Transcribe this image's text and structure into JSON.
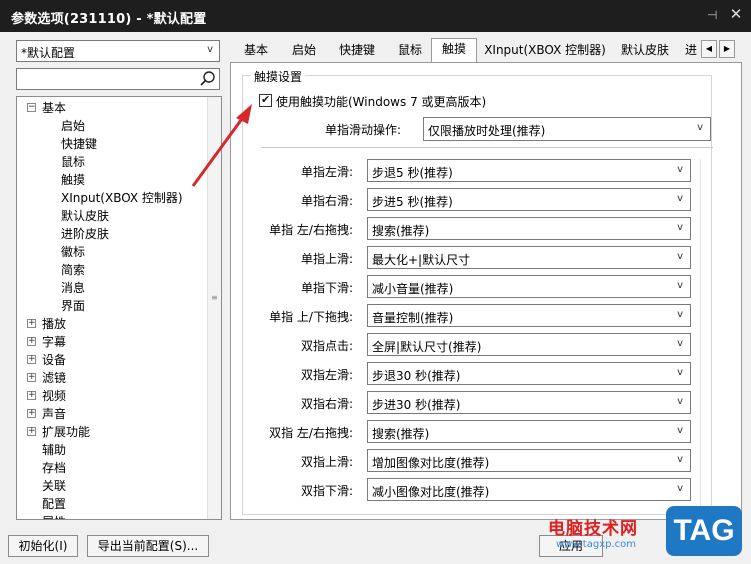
{
  "window": {
    "title": "参数选项(231110) - *默认配置",
    "pin_glyph": "⊣",
    "close_glyph": "✕"
  },
  "profile": {
    "value": "*默认配置"
  },
  "search": {
    "value": ""
  },
  "tree": {
    "items": [
      {
        "label": "基本",
        "expander": "⊟"
      },
      {
        "label": "启始"
      },
      {
        "label": "快捷键"
      },
      {
        "label": "鼠标"
      },
      {
        "label": "触摸"
      },
      {
        "label": "XInput(XBOX 控制器)"
      },
      {
        "label": "默认皮肤"
      },
      {
        "label": "进阶皮肤"
      },
      {
        "label": "徽标"
      },
      {
        "label": "简索"
      },
      {
        "label": "消息"
      },
      {
        "label": "界面"
      },
      {
        "label": "播放",
        "expander": "⊞"
      },
      {
        "label": "字幕",
        "expander": "⊞"
      },
      {
        "label": "设备",
        "expander": "⊞"
      },
      {
        "label": "滤镜",
        "expander": "⊞"
      },
      {
        "label": "视频",
        "expander": "⊞"
      },
      {
        "label": "声音",
        "expander": "⊞"
      },
      {
        "label": "扩展功能",
        "expander": "⊞"
      },
      {
        "label": "辅助"
      },
      {
        "label": "存档"
      },
      {
        "label": "关联"
      },
      {
        "label": "配置"
      },
      {
        "label": "属性"
      }
    ]
  },
  "tabs": [
    {
      "label": "基本"
    },
    {
      "label": "启始"
    },
    {
      "label": "快捷键"
    },
    {
      "label": "鼠标"
    },
    {
      "label": "触摸"
    },
    {
      "label": "XInput(XBOX 控制器)"
    },
    {
      "label": "默认皮肤"
    },
    {
      "label": "进"
    }
  ],
  "touch": {
    "group_title": "触摸设置",
    "enable_label": "使用触摸功能(Windows 7 或更高版本)",
    "enable_checked": true,
    "single_label": "单指滑动操作:",
    "single_value": "仅限播放时处理(推荐)",
    "gestures": [
      {
        "label": "单指左滑:",
        "value": "步退5 秒(推荐)"
      },
      {
        "label": "单指右滑:",
        "value": "步进5 秒(推荐)"
      },
      {
        "label": "单指 左/右拖拽:",
        "value": "搜索(推荐)"
      },
      {
        "label": "单指上滑:",
        "value": "最大化+|默认尺寸"
      },
      {
        "label": "单指下滑:",
        "value": "减小音量(推荐)"
      },
      {
        "label": "单指 上/下拖拽:",
        "value": "音量控制(推荐)"
      },
      {
        "label": "双指点击:",
        "value": "全屏|默认尺寸(推荐)"
      },
      {
        "label": "双指左滑:",
        "value": "步退30 秒(推荐)"
      },
      {
        "label": "双指右滑:",
        "value": "步进30 秒(推荐)"
      },
      {
        "label": "双指 左/右拖拽:",
        "value": "搜索(推荐)"
      },
      {
        "label": "双指上滑:",
        "value": "增加图像对比度(推荐)"
      },
      {
        "label": "双指下滑:",
        "value": "减小图像对比度(推荐)"
      }
    ]
  },
  "footer": {
    "init_label": "初始化(I)",
    "export_label": "导出当前配置(S)...",
    "apply_label": "应用"
  },
  "watermark": {
    "text": "电脑技术网",
    "url": "www.tagxp.com",
    "tag": "TAG"
  },
  "colors": {
    "titlebar": "#1e1e1e",
    "annotation_arrow": "#d42a2a",
    "watermark_red": "#e02020",
    "watermark_blue": "#1f78c4"
  }
}
